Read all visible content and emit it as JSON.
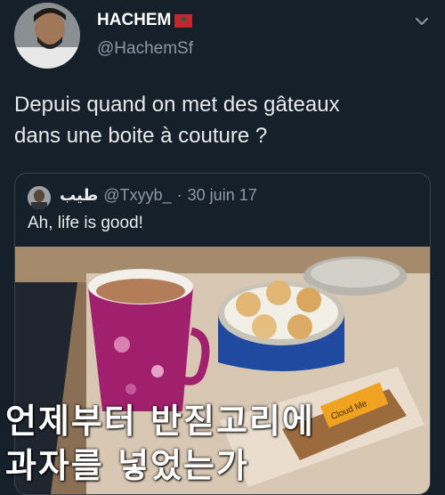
{
  "author": {
    "display_name": "HACHEM",
    "handle": "@HachemSf"
  },
  "tweet": {
    "text_line1": "Depuis quand on met des gâteaux",
    "text_line2": "dans une boite à couture ?"
  },
  "quoted": {
    "display_name": "طيب",
    "handle": "@Txyyb_",
    "separator": "·",
    "date": "30 juin 17",
    "text": "Ah, life is good!",
    "package_label": "Cloud Me"
  },
  "overlay": {
    "line1": "언제부터 반짇고리에",
    "line2": "과자를 넣었는가"
  },
  "colors": {
    "background": "#15202b",
    "text": "#e7e9ea",
    "muted": "#8b98a5",
    "border": "#38444d"
  },
  "icons": {
    "chevron": "chevron-down-icon",
    "flag": "morocco-flag-icon"
  }
}
